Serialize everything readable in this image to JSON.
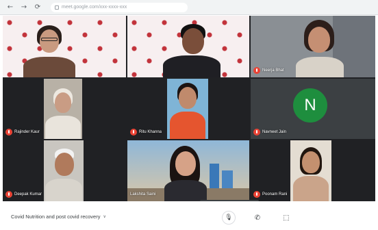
{
  "browser": {
    "back_glyph": "←",
    "forward_glyph": "→",
    "reload_glyph": "⟳",
    "url": "meet.google.com/xxx-xxxx-xxx"
  },
  "tiles": [
    {
      "label": ""
    },
    {
      "label": ""
    },
    {
      "label": "Neerja Bhat"
    },
    {
      "label": "Rajinder Kaur"
    },
    {
      "label": "Ritu Khanna"
    },
    {
      "label": "Navneet Jain",
      "avatar_letter": "N",
      "avatar_color": "#1e8e3e"
    },
    {
      "label": "Deepak Kumar"
    },
    {
      "label": "Lakshita Saini"
    },
    {
      "label": "Poonam Rani"
    }
  ],
  "bottom_bar": {
    "meeting_title": "Covid Nutrition and post covid recovery",
    "caret": "∨",
    "mic_glyph": "🎙",
    "hangup_glyph": "✆",
    "camera_glyph": "⬚"
  },
  "colors": {
    "mic_off": "#ea4335",
    "grid_bg": "#202124",
    "accent_green": "#1e8e3e"
  }
}
